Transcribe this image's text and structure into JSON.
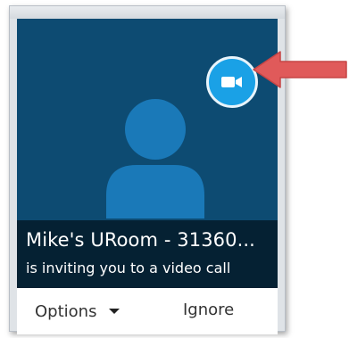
{
  "call": {
    "caller_name": "Mike's URoom - 31360...",
    "subtitle": "is inviting you to a video call"
  },
  "actions": {
    "options_label": "Options",
    "ignore_label": "Ignore"
  },
  "icons": {
    "video": "video-camera-icon",
    "avatar": "person-silhouette-icon",
    "options_menu": "chevron-down-icon",
    "annotation": "red-arrow-icon"
  },
  "colors": {
    "call_background": "#0d4b72",
    "avatar": "#1a79b8",
    "video_button": "#1aa1e6",
    "overlay": "#000000",
    "annotation_arrow": "#e05a5a"
  }
}
